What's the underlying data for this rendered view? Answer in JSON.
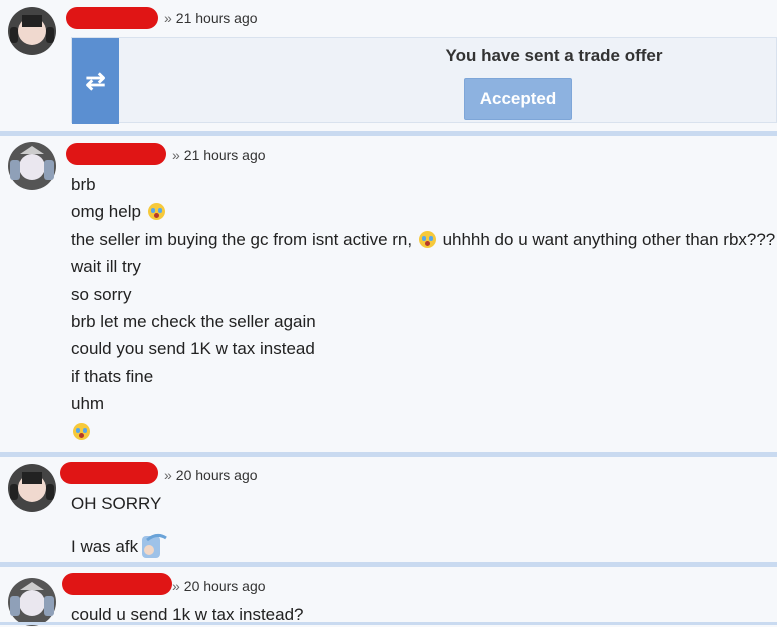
{
  "messages": [
    {
      "meta": "21 hours ago",
      "trade": {
        "title": "You have sent a trade offer",
        "status": "Accepted",
        "icon": "trade-swap-icon"
      }
    },
    {
      "meta": "21 hours ago",
      "lines": [
        "brb",
        "omg help",
        "the seller im buying the gc from isnt active rn,",
        "uhhhh do u want anything other than rbx???",
        "wait ill try",
        "so sorry",
        "brb let me check the seller again",
        "could you send 1K w tax instead",
        "if thats fine",
        "uhm"
      ]
    },
    {
      "meta": "20 hours ago",
      "lines": [
        "OH SORRY",
        "I was afk"
      ]
    },
    {
      "meta": "20 hours ago",
      "lines": [
        "could u send 1k w tax instead?"
      ]
    }
  ],
  "separator": "»",
  "colors": {
    "accent": "#5b8fd1",
    "redaction": "#e01515",
    "border": "#c9daf0"
  }
}
